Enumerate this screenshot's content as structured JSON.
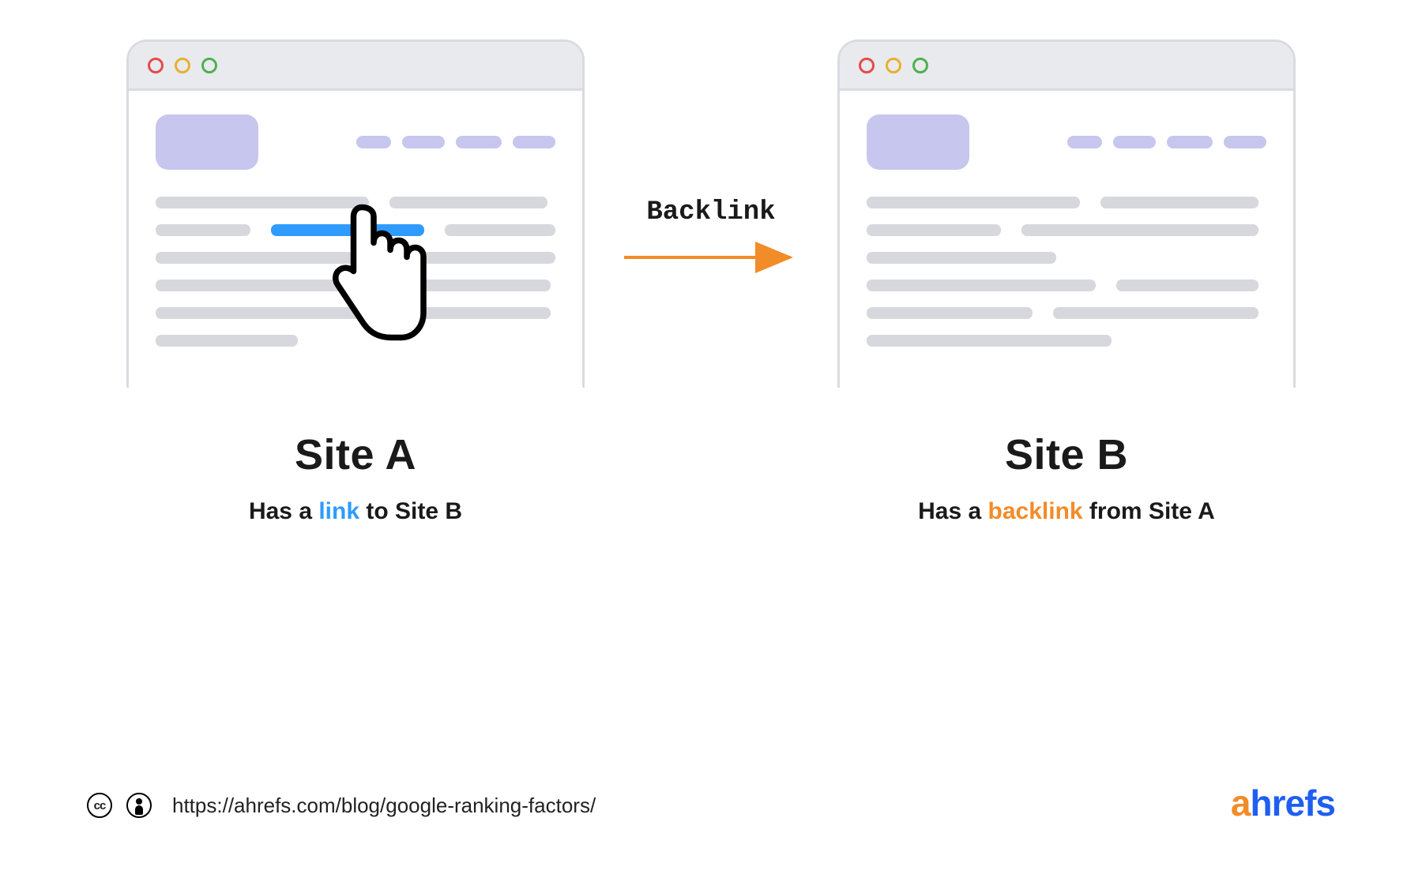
{
  "arrow": {
    "label": "Backlink",
    "color": "#f28c28"
  },
  "siteA": {
    "title": "Site A",
    "caption_pre": "Has a ",
    "caption_kw": "link",
    "caption_post": " to Site B"
  },
  "siteB": {
    "title": "Site B",
    "caption_pre": "Has a ",
    "caption_kw": "backlink",
    "caption_post": " from Site A"
  },
  "footer": {
    "url": "https://ahrefs.com/blog/google-ranking-factors/"
  },
  "brand": {
    "name": "ahrefs"
  },
  "colors": {
    "link": "#2f9bff",
    "backlink": "#f28c28",
    "lavender": "#c6c6ef",
    "grey": "#d6d8dd"
  }
}
